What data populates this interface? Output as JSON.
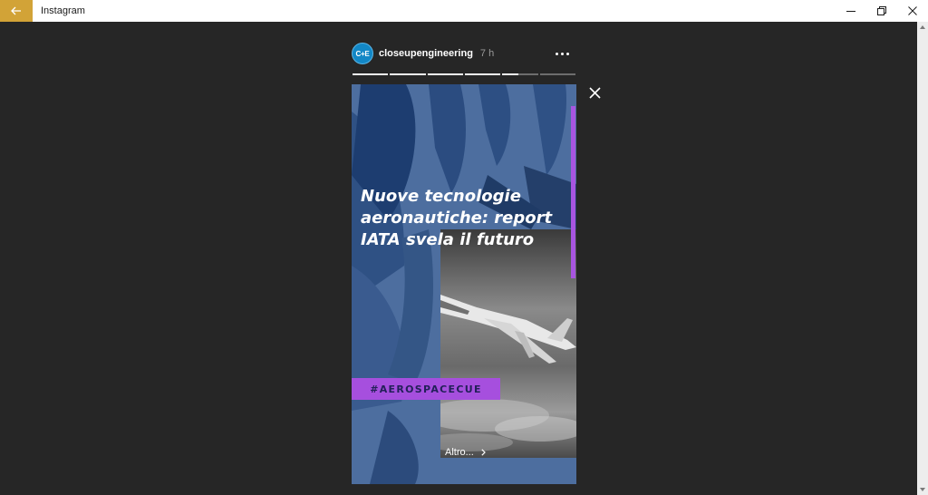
{
  "window": {
    "title": "Instagram"
  },
  "icons": {
    "back": "arrow-left-icon",
    "minimize": "minimize-icon",
    "restore": "restore-icon",
    "close": "close-icon",
    "story_close": "close-icon",
    "more": "more-horizontal-icon",
    "more_link": "chevron-right-icon"
  },
  "colors": {
    "accent_back": "#d2a337",
    "story_blue": "#4d6e9f",
    "hashtag_purple": "#a64fde",
    "avatar_blue": "#1287c6"
  },
  "story": {
    "avatar_text": "C+E",
    "username": "closeupengineering",
    "time_ago": "7 h",
    "progress": [
      1,
      1,
      1,
      1,
      0.45,
      0
    ],
    "headline_lines": [
      "Nuove tecnologie",
      "aeronautiche: report",
      "IATA svela il futuro"
    ],
    "hashtag": "#AEROSPACECUE",
    "more_label": "Altro..."
  }
}
